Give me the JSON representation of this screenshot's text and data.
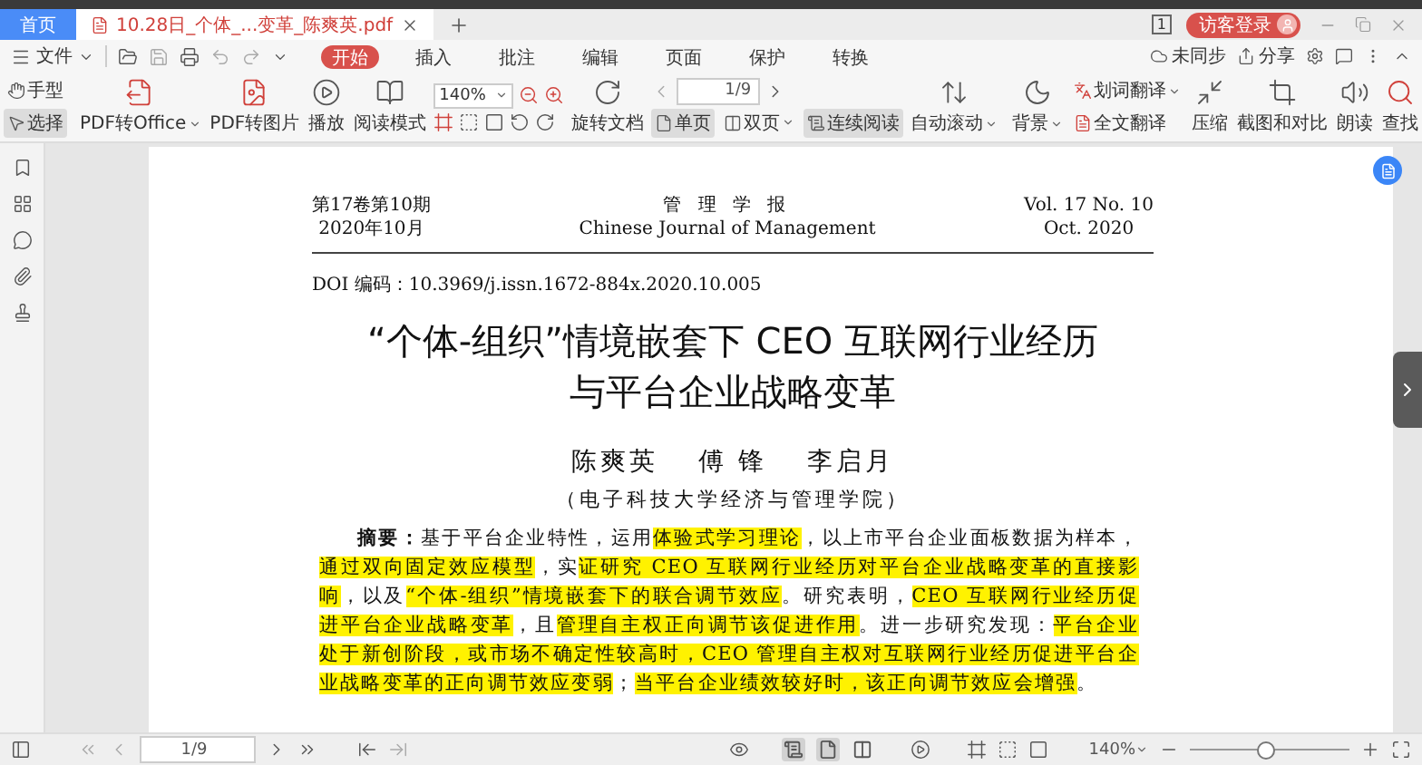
{
  "tab_bar": {
    "tabs": [
      {
        "kind": "home",
        "label": "首页",
        "selected": false
      },
      {
        "kind": "document",
        "label": "10.28日_个体_...变革_陈爽英.pdf",
        "selected": true
      }
    ],
    "badge": "1",
    "login_button": "访客登录"
  },
  "menu_bar": {
    "file_menu": "文件",
    "tabs": [
      {
        "label": "开始",
        "selected": true
      },
      {
        "label": "插入",
        "selected": false
      },
      {
        "label": "批注",
        "selected": false
      },
      {
        "label": "编辑",
        "selected": false
      },
      {
        "label": "页面",
        "selected": false
      },
      {
        "label": "保护",
        "selected": false
      },
      {
        "label": "转换",
        "selected": false
      }
    ],
    "sync_status": "未同步",
    "share": "分享"
  },
  "ribbon": {
    "cursor_tools": [
      {
        "kind": "hand",
        "label": "手型",
        "selected": false
      },
      {
        "kind": "select",
        "label": "选择",
        "selected": true
      }
    ],
    "convert": [
      {
        "kind": "pdf-office",
        "label": "PDF转Office",
        "dropdown": true
      },
      {
        "kind": "pdf-image",
        "label": "PDF转图片",
        "dropdown": false
      },
      {
        "kind": "play",
        "label": "播放",
        "dropdown": false
      },
      {
        "kind": "read",
        "label": "阅读模式",
        "dropdown": false
      }
    ],
    "zoom": "140%",
    "rotate": "旋转文档",
    "page": "1/9",
    "layouts": [
      {
        "kind": "single",
        "label": "单页",
        "selected": true,
        "dropdown": false
      },
      {
        "kind": "double",
        "label": "双页",
        "selected": false,
        "dropdown": true
      },
      {
        "kind": "continuous",
        "label": "连续阅读",
        "selected": true,
        "dropdown": false
      }
    ],
    "auto_scroll": "自动滚动",
    "background": "背景",
    "translate": [
      {
        "kind": "word",
        "label": "划词翻译",
        "dropdown": true
      },
      {
        "kind": "full",
        "label": "全文翻译",
        "dropdown": false
      }
    ],
    "tools": [
      {
        "kind": "compress",
        "label": "压缩"
      },
      {
        "kind": "compare",
        "label": "截图和对比"
      },
      {
        "kind": "speak",
        "label": "朗读"
      },
      {
        "kind": "find",
        "label": "查找"
      }
    ]
  },
  "document": {
    "header_left": [
      "第17卷第10期",
      "2020年10月"
    ],
    "journal": [
      "管 理 学 报",
      "Chinese Journal of Management"
    ],
    "header_right": [
      "Vol. 17 No. 10",
      "Oct. 2020"
    ],
    "doi": "DOI 编码：10.3969/j.issn.1672-884x.2020.10.005",
    "title": [
      "“个体-组织”情境嵌套下 CEO 互联网行业经历",
      "与平台企业战略变革"
    ],
    "authors": [
      "陈爽英",
      "傅 锋",
      "李启月"
    ],
    "affiliation": "（电子科技大学经济与管理学院）",
    "abstract": {
      "label": "摘要：",
      "segments": [
        {
          "text": "基于平台企业特性，运用",
          "highlighted": false
        },
        {
          "text": "体验式学习理论",
          "highlighted": true
        },
        {
          "text": "，以上市平台企业面板数据为样本，",
          "highlighted": false
        },
        {
          "text": "通过双向固定效应模型",
          "highlighted": true
        },
        {
          "text": "，实",
          "highlighted": false
        },
        {
          "text": "证研究 CEO 互联网行业经历对平台企业战略变革的直接影响",
          "highlighted": true
        },
        {
          "text": "，以及",
          "highlighted": false
        },
        {
          "text": "“个体-组织”情境嵌套下的联合调节效应",
          "highlighted": true
        },
        {
          "text": "。研究表明，",
          "highlighted": false
        },
        {
          "text": "CEO 互联网行业经历促进平台企业战略变革",
          "highlighted": true
        },
        {
          "text": "，且",
          "highlighted": false
        },
        {
          "text": "管理自主权正向调节该促进作用",
          "highlighted": true
        },
        {
          "text": "。进一步研究发现：",
          "highlighted": false
        },
        {
          "text": "平台企业处于新创阶段，或市场不确定性较高时，CEO 管理自主权对互联网行业经历促进平台企业战略变革的正向调节效应变弱",
          "highlighted": true
        },
        {
          "text": "；",
          "highlighted": false
        },
        {
          "text": "当平台企业绩效较好时，该正向调节效应会增强",
          "highlighted": true
        },
        {
          "text": "。",
          "highlighted": false
        }
      ]
    }
  },
  "status_bar": {
    "page": "1/9",
    "view_modes": [
      {
        "kind": "continuous",
        "selected": true
      },
      {
        "kind": "single",
        "selected": true
      },
      {
        "kind": "double",
        "selected": false
      }
    ],
    "zoom": "140%",
    "zoom_slider": {
      "level": 0.48
    }
  }
}
